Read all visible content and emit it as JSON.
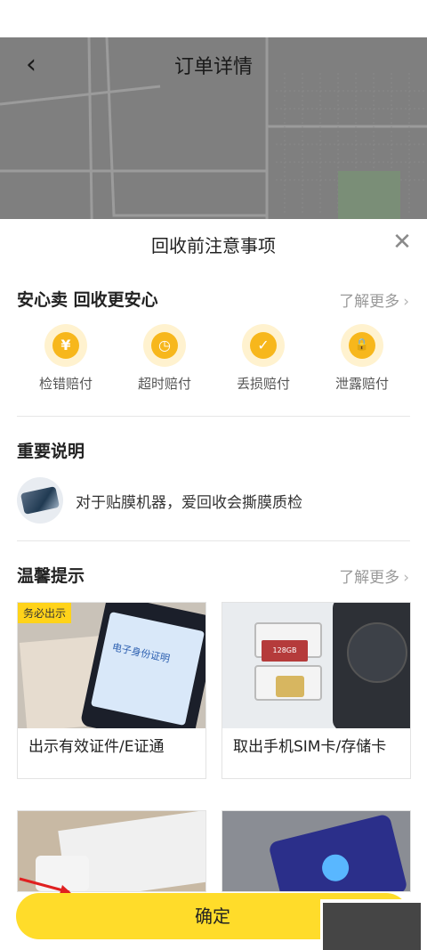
{
  "header": {
    "title": "订单详情",
    "back_icon": "‹"
  },
  "sheet": {
    "title": "回收前注意事项",
    "close_icon": "✕",
    "section_safe": {
      "title": "安心卖 回收更安心",
      "more": "了解更多",
      "items": [
        {
          "label": "检错赔付",
          "icon": "money-bag-icon",
          "glyph": "¥"
        },
        {
          "label": "超时赔付",
          "icon": "stopwatch-icon",
          "glyph": "◷"
        },
        {
          "label": "丢损赔付",
          "icon": "shield-check-icon",
          "glyph": "✓"
        },
        {
          "label": "泄露赔付",
          "icon": "lock-icon",
          "glyph": "🔒"
        }
      ]
    },
    "section_important": {
      "title": "重要说明",
      "note": "对于贴膜机器，爱回收会撕膜质检"
    },
    "section_tips": {
      "title": "温馨提示",
      "more": "了解更多",
      "cards": [
        {
          "badge": "务必出示",
          "caption": "出示有效证件/E证通",
          "img_text": "电子身份证明"
        },
        {
          "caption": "取出手机SIM卡/存储卡",
          "img_text": "128GB"
        },
        {
          "caption": ""
        },
        {
          "caption": ""
        }
      ]
    }
  },
  "footer": {
    "confirm_label": "确定"
  },
  "colors": {
    "accent": "#ffdc2a",
    "icon_bg": "#fff2cf",
    "icon_fg": "#f7b71c"
  }
}
